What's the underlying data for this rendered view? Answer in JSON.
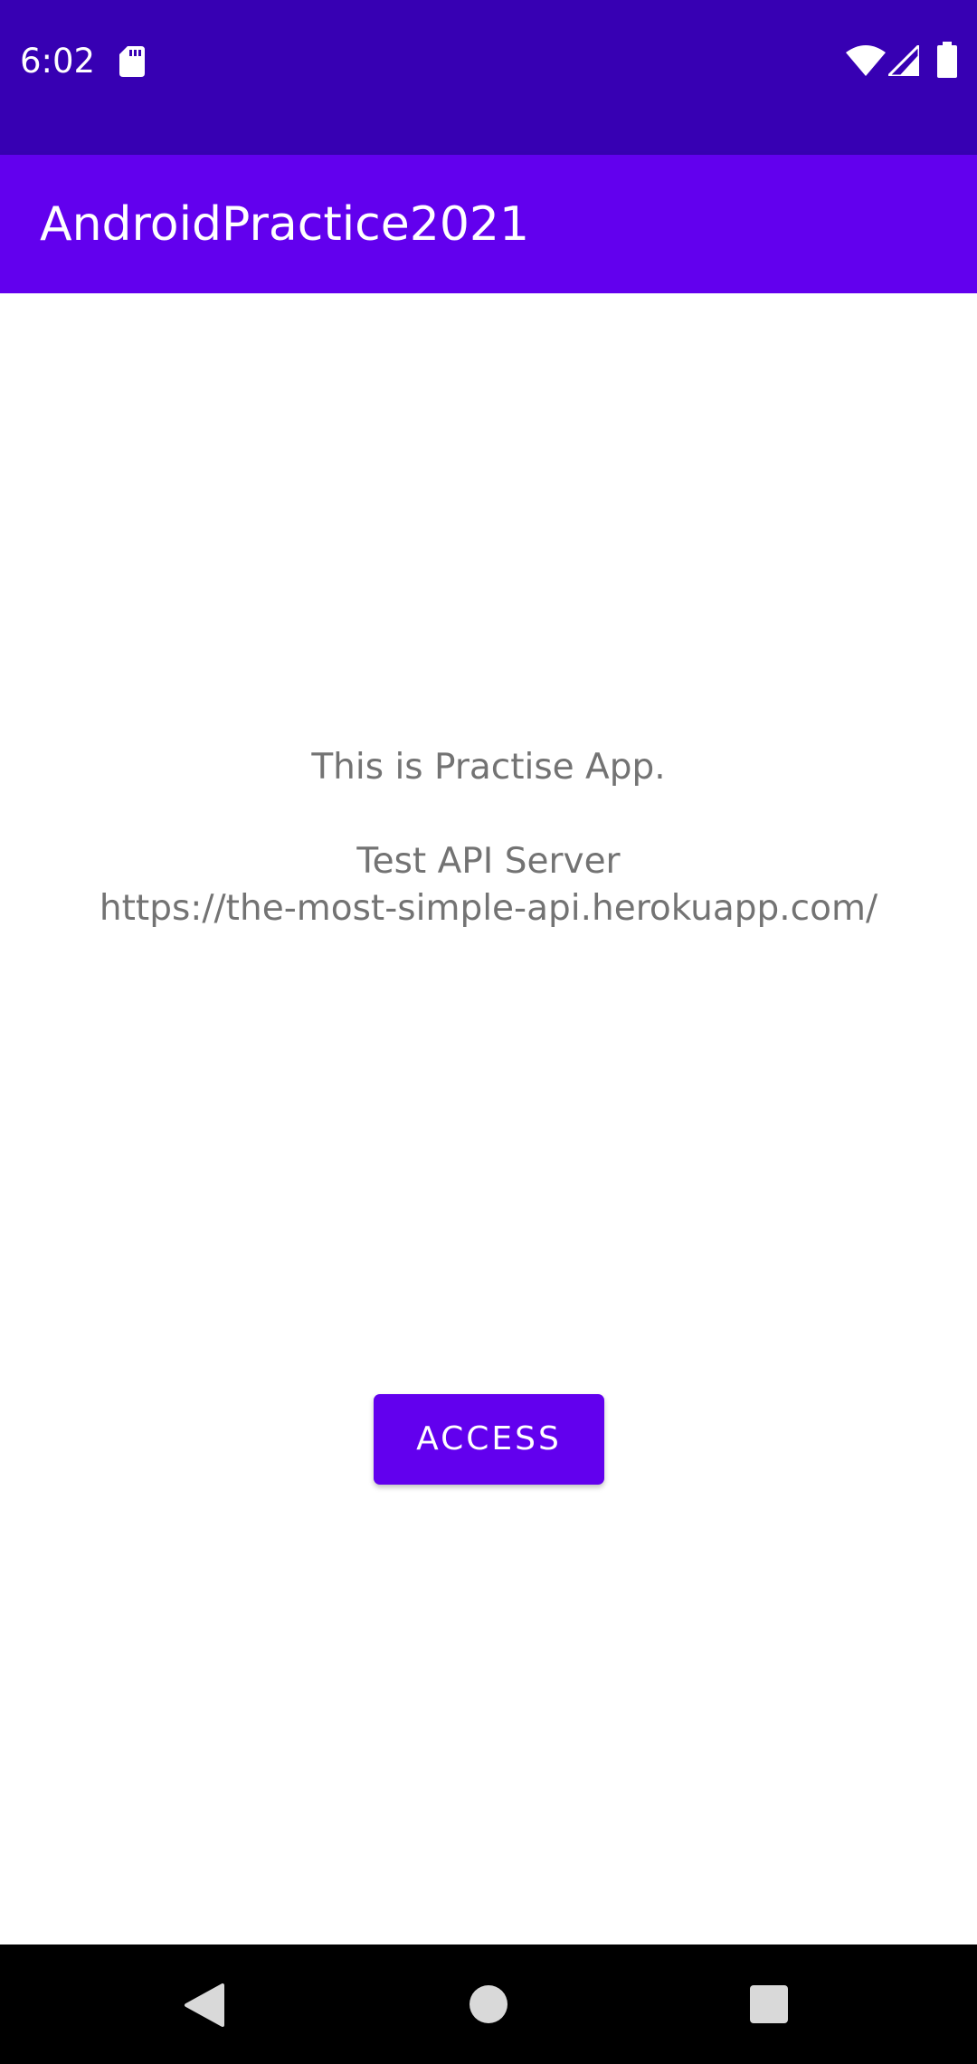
{
  "status_bar": {
    "time": "6:02",
    "icons": [
      "sd-card-icon",
      "wifi-icon",
      "signal-icon",
      "battery-icon"
    ]
  },
  "app_bar": {
    "title": "AndroidPractice2021"
  },
  "main": {
    "message_line1": "This is Practise App.",
    "message_line2": "Test API Server",
    "message_line3": "https://the-most-simple-api.herokuapp.com/",
    "access_button_label": "ACCESS"
  },
  "nav_bar": {
    "icons": [
      "back-icon",
      "home-icon",
      "recents-icon"
    ]
  },
  "colors": {
    "status_bar": "#3700B3",
    "primary": "#6200EE",
    "message_text": "#737373",
    "nav_bar": "#000000"
  }
}
